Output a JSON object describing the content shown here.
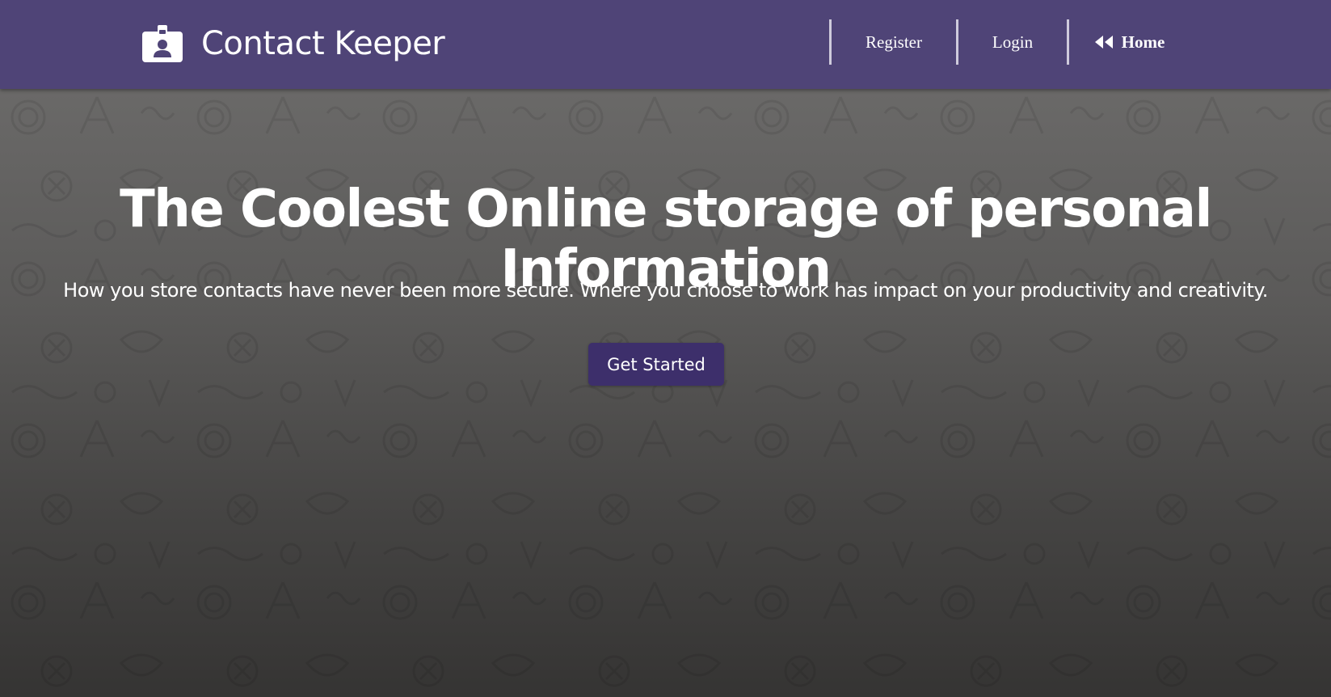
{
  "header": {
    "brand_name": "Contact Keeper",
    "brand_icon": "id-badge-icon",
    "nav": {
      "register": "Register",
      "login": "Login",
      "home": "Home",
      "home_icon": "backward-icon"
    },
    "background_color": "#4f4477"
  },
  "hero": {
    "title": "The Coolest Online storage of personal Information",
    "lead": "How you store contacts have never been more secure. Where you choose to work has impact on your productivity and creativity.",
    "cta_label": "Get Started",
    "cta_color": "#3d2f6b"
  }
}
